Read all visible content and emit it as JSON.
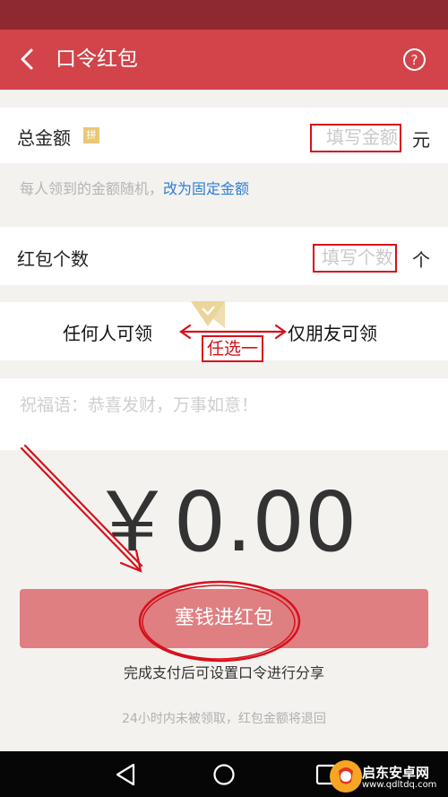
{
  "header": {
    "title": "口令红包",
    "back_icon": "chevron-left-icon",
    "help_icon": "question-circle-icon"
  },
  "total_amount": {
    "label": "总金额",
    "badge": "拼",
    "placeholder": "填写金额",
    "unit": "元"
  },
  "hint": {
    "text": "每人领到的金额随机，",
    "link": "改为固定金额"
  },
  "count": {
    "label": "红包个数",
    "placeholder": "填写个数",
    "unit": "个"
  },
  "scope": {
    "option_any": "任何人可领",
    "option_friends": "仅朋友可领",
    "annotation": "任选一"
  },
  "wish": {
    "placeholder": "祝福语：恭喜发财，万事如意！"
  },
  "amount_display": "￥0.00",
  "submit_button": "塞钱进红包",
  "sub_text": "完成支付后可设置口令进行分享",
  "footer_text": "24小时内未被领取，红包金额将退回",
  "nav": {
    "back_icon": "triangle-back-icon",
    "home_icon": "circle-home-icon",
    "recents_icon": "square-recents-icon"
  },
  "watermark": {
    "title": "启东安卓网",
    "url": "www.qdltdq.com"
  },
  "colors": {
    "status_bar": "#8e2930",
    "title_bar": "#d2434a",
    "button": "#df7f81",
    "link": "#2b7fd4",
    "annotation": "#d6101b"
  }
}
